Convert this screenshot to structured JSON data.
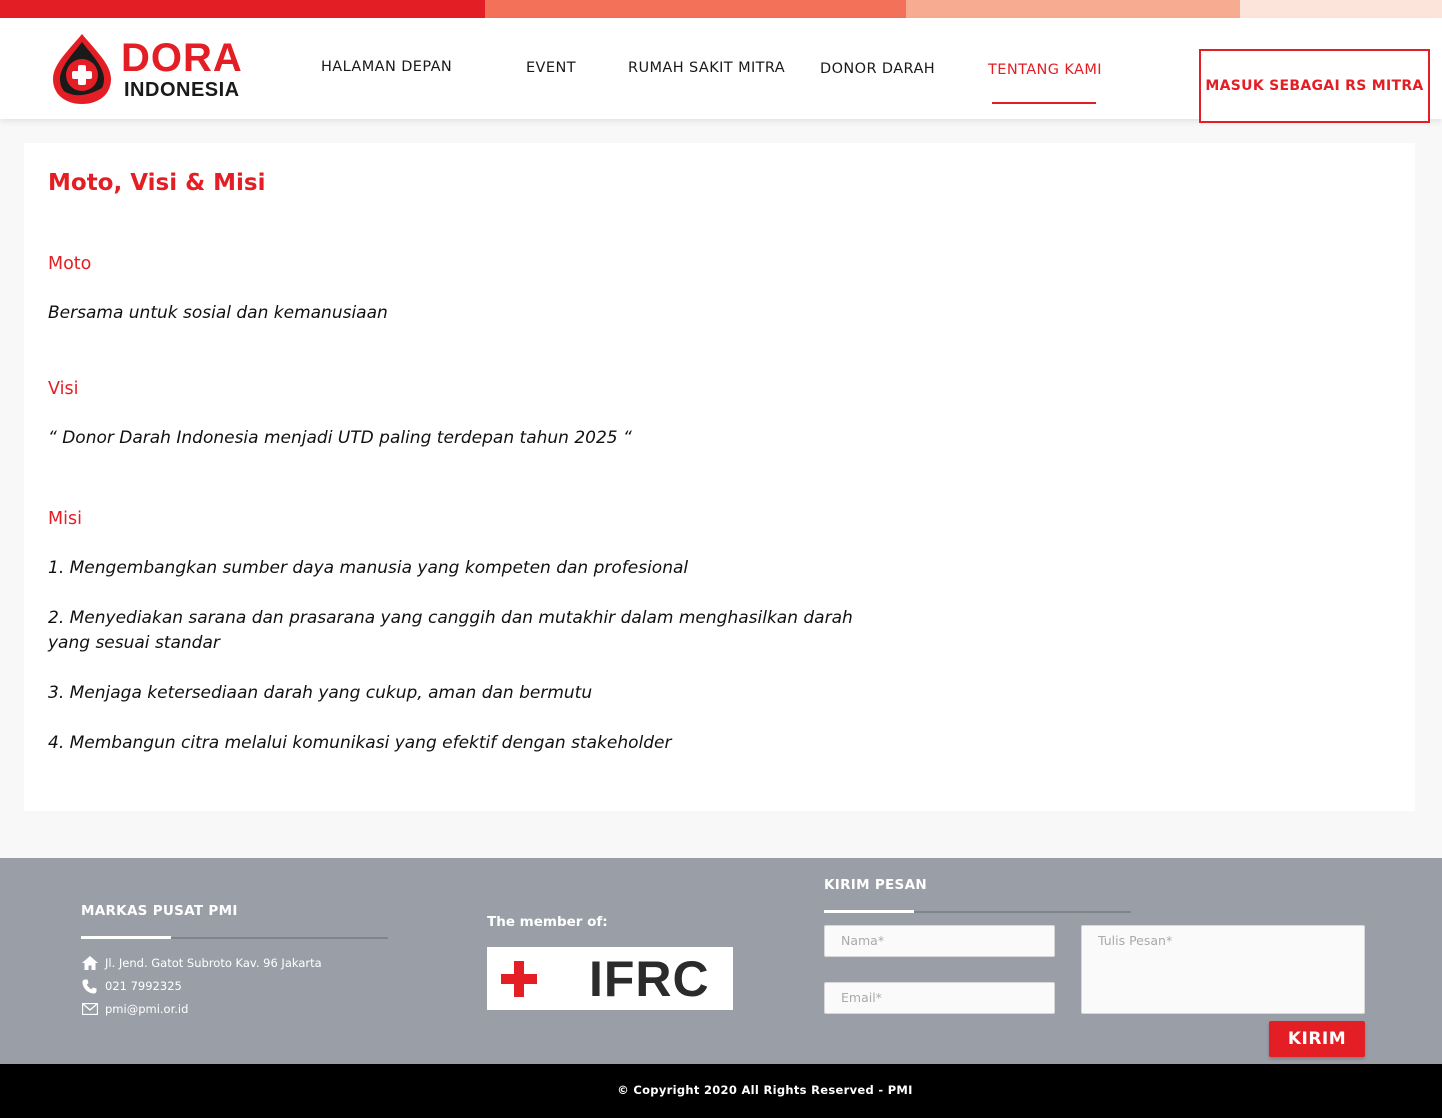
{
  "colors": {
    "brand_red": "#e31e24",
    "strip": [
      "#e31e24",
      "#f37158",
      "#f7ab90",
      "#fde4db"
    ],
    "footer_bg": "#9a9fa7",
    "bottom_bar": "#000000"
  },
  "header": {
    "logo_line1": "DORA",
    "logo_line2": "INDONESIA",
    "nav": [
      "HALAMAN DEPAN",
      "EVENT",
      "RUMAH SAKIT MITRA",
      "DONOR DARAH",
      "TENTANG KAMI"
    ],
    "active_nav": "TENTANG KAMI",
    "login_label": "MASUK SEBAGAI RS MITRA"
  },
  "content": {
    "title": "Moto, Visi & Misi",
    "moto_heading": "Moto",
    "moto_text": "Bersama untuk sosial dan kemanusiaan",
    "visi_heading": "Visi",
    "visi_text": "“ Donor Darah Indonesia menjadi UTD paling terdepan tahun 2025 “",
    "misi_heading": "Misi",
    "misi_items": [
      "1. Mengembangkan sumber daya manusia yang kompeten dan profesional",
      "2. Menyediakan sarana dan prasarana yang canggih dan mutakhir dalam menghasilkan darah yang sesuai standar",
      "3. Menjaga ketersediaan darah yang cukup, aman dan bermutu",
      "4. Membangun citra melalui komunikasi yang efektif dengan stakeholder"
    ]
  },
  "footer": {
    "hq_heading": "MARKAS PUSAT PMI",
    "address": "Jl. Jend. Gatot Subroto Kav. 96 Jakarta",
    "phone": "021 7992325",
    "email": "pmi@pmi.or.id",
    "member_label": "The member of:",
    "ifrc_text": "IFRC",
    "contact_heading": "KIRIM PESAN",
    "name_placeholder": "Nama*",
    "email_placeholder": "Email*",
    "message_placeholder": "Tulis Pesan*",
    "send_label": "KIRIM"
  },
  "copyright": "© Copyright 2020 All Rights Reserved - PMI"
}
